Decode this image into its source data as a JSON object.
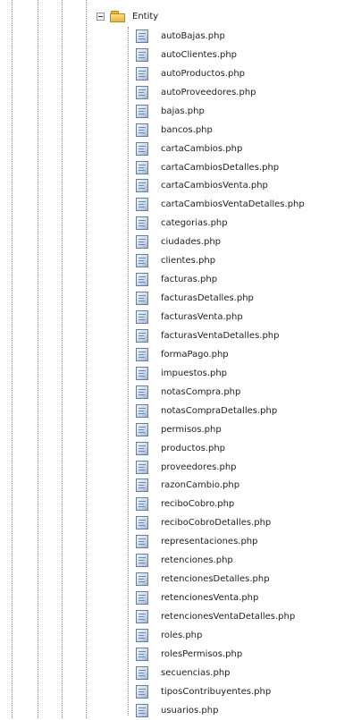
{
  "tree": {
    "folder": {
      "label": "Entity",
      "expanded": true,
      "icon": "folder-open-icon",
      "toggle_icon": "minus-toggle-icon"
    },
    "file_icon": "php-file-icon",
    "files": [
      "autoBajas.php",
      "autoClientes.php",
      "autoProductos.php",
      "autoProveedores.php",
      "bajas.php",
      "bancos.php",
      "cartaCambios.php",
      "cartaCambiosDetalles.php",
      "cartaCambiosVenta.php",
      "cartaCambiosVentaDetalles.php",
      "categorias.php",
      "ciudades.php",
      "clientes.php",
      "facturas.php",
      "facturasDetalles.php",
      "facturasVenta.php",
      "facturasVentaDetalles.php",
      "formaPago.php",
      "impuestos.php",
      "notasCompra.php",
      "notasCompraDetalles.php",
      "permisos.php",
      "productos.php",
      "proveedores.php",
      "razonCambio.php",
      "reciboCobro.php",
      "reciboCobroDetalles.php",
      "representaciones.php",
      "retenciones.php",
      "retencionesDetalles.php",
      "retencionesVenta.php",
      "retencionesVentaDetalles.php",
      "roles.php",
      "rolesPermisos.php",
      "secuencias.php",
      "tiposContribuyentes.php",
      "usuarios.php"
    ]
  }
}
